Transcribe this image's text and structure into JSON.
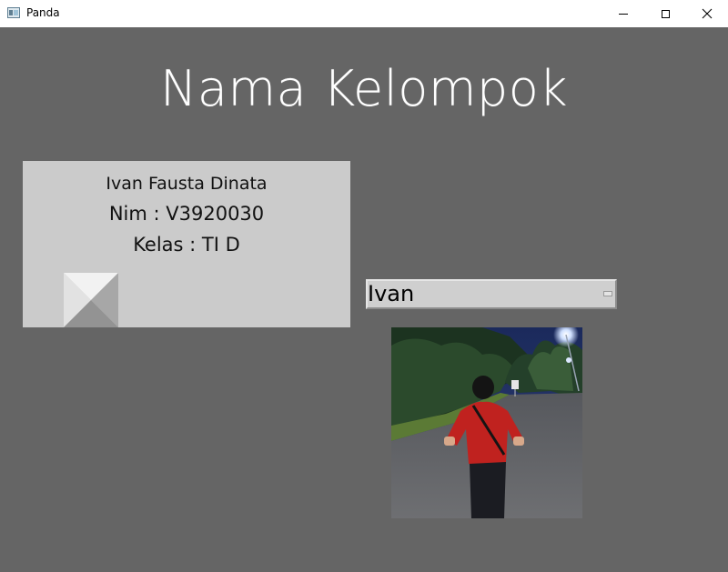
{
  "window": {
    "title": "Panda",
    "icon": "panda-app-icon",
    "controls": [
      "minimize",
      "maximize",
      "close"
    ]
  },
  "heading": "Nama Kelompok",
  "card": {
    "name": "Ivan Fausta Dinata",
    "nim": "Nim : V3920030",
    "kelas": "Kelas : TI D"
  },
  "dropdown": {
    "selected": "Ivan"
  },
  "colors": {
    "background": "#656565",
    "card": "#cbcbcb",
    "heading": "#ffffff"
  }
}
